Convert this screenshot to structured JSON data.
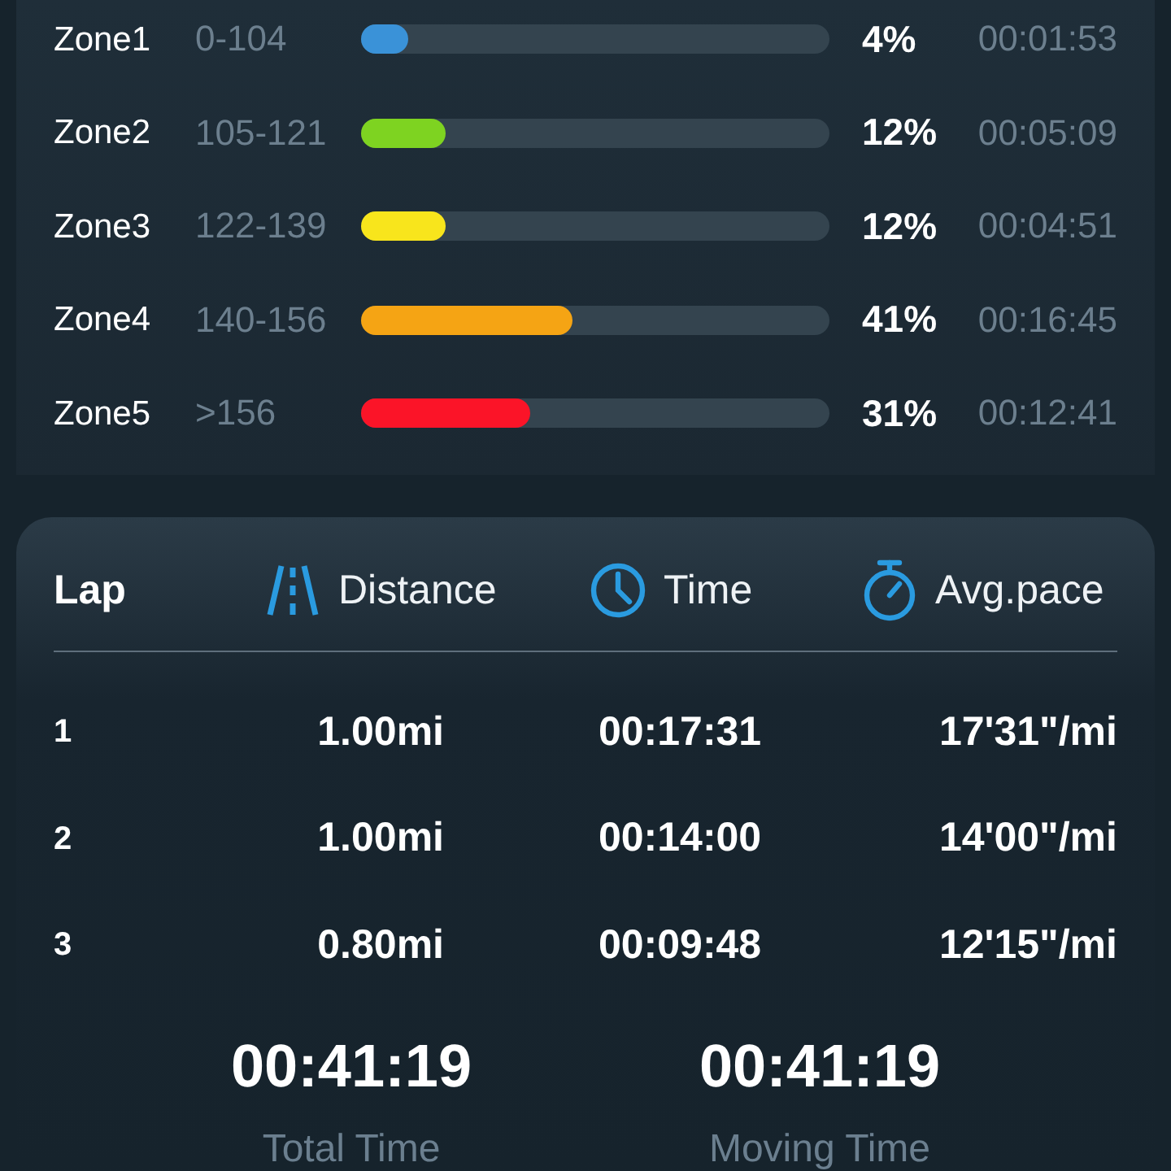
{
  "heart_rate_zones": [
    {
      "name": "Zone1",
      "range": "0-104",
      "color": "#3a92d8",
      "level": 0.1,
      "percent": "4%",
      "duration": "00:01:53"
    },
    {
      "name": "Zone2",
      "range": "105-121",
      "color": "#7ed321",
      "level": 0.18,
      "percent": "12%",
      "duration": "00:05:09"
    },
    {
      "name": "Zone3",
      "range": "122-139",
      "color": "#f8e51c",
      "level": 0.18,
      "percent": "12%",
      "duration": "00:04:51"
    },
    {
      "name": "Zone4",
      "range": "140-156",
      "color": "#f5a414",
      "level": 0.45,
      "percent": "41%",
      "duration": "00:16:45"
    },
    {
      "name": "Zone5",
      "range": ">156",
      "color": "#fb1428",
      "level": 0.36,
      "percent": "31%",
      "duration": "00:12:41"
    }
  ],
  "laps": {
    "columns": [
      {
        "label": "Lap",
        "kind": "lap"
      },
      {
        "label": "Distance",
        "kind": "distance"
      },
      {
        "label": "Time",
        "kind": "time"
      },
      {
        "label": "Avg.pace",
        "kind": "pace"
      }
    ],
    "rows": [
      {
        "lap": "1",
        "distance": "1.00mi",
        "time": "00:17:31",
        "pace": "17'31\"/mi"
      },
      {
        "lap": "2",
        "distance": "1.00mi",
        "time": "00:14:00",
        "pace": "14'00\"/mi"
      },
      {
        "lap": "3",
        "distance": "0.80mi",
        "time": "00:09:48",
        "pace": "12'15\"/mi"
      }
    ]
  },
  "totals": [
    {
      "value": "00:41:19",
      "label": "Total Time"
    },
    {
      "value": "00:41:19",
      "label": "Moving Time"
    }
  ]
}
